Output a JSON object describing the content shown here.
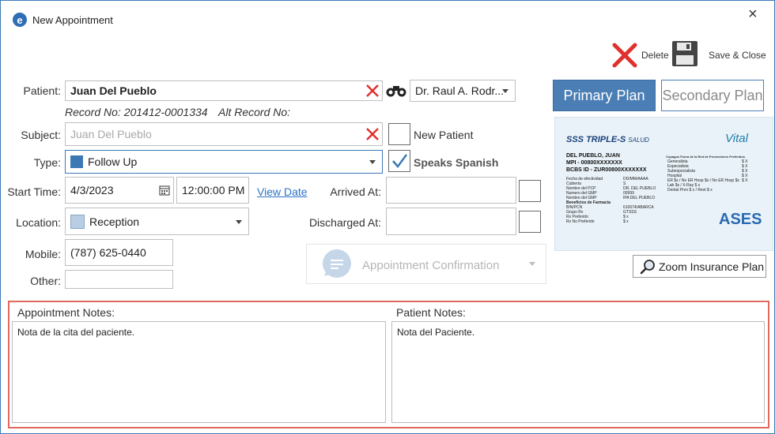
{
  "window": {
    "title": "New Appointment",
    "close_glyph": "×"
  },
  "toolbar": {
    "delete_label": "Delete",
    "save_close_label": "Save & Close"
  },
  "patient": {
    "label": "Patient:",
    "value": "Juan Del Pueblo",
    "record_no": "Record No: 201412-0001334",
    "alt_record_no": "Alt Record No:",
    "doctor": "Dr. Raul A. Rodr..."
  },
  "subject": {
    "label": "Subject:",
    "placeholder": "Juan Del Pueblo"
  },
  "new_patient_label": "New Patient",
  "speaks_spanish_label": "Speaks Spanish",
  "type": {
    "label": "Type:",
    "value": "Follow Up",
    "color": "#3c78b4"
  },
  "start_time": {
    "label": "Start Time:",
    "date": "4/3/2023",
    "time": "12:00:00 PM",
    "view_date_link": "View Date"
  },
  "arrived_at_label": "Arrived At:",
  "discharged_at_label": "Discharged At:",
  "location": {
    "label": "Location:",
    "value": "Reception",
    "color": "#b9cde4"
  },
  "mobile": {
    "label": "Mobile:",
    "value": "(787) 625-0440"
  },
  "other": {
    "label": "Other:",
    "value": ""
  },
  "appointment_confirmation_label": "Appointment Confirmation",
  "plans": {
    "primary": "Primary Plan",
    "secondary": "Secondary Plan",
    "zoom": "Zoom Insurance Plan"
  },
  "insurance_card": {
    "brand": "TRIPLE-S",
    "brand_suffix": "SALUD",
    "partner": "Vital",
    "name": "DEL PUEBLO, JUAN",
    "mpi": "MPI - 00800XXXXXXX",
    "bcbs": "BCBS ID - ZUR00800XXXXXXX",
    "fields": [
      {
        "k": "Fecha de efectividad",
        "v": "DD/MM/AAAA"
      },
      {
        "k": "Cubierta",
        "v": "S"
      },
      {
        "k": "Nombre del PCP",
        "v": "DR. DEL PUEBLO"
      },
      {
        "k": "Numero del GMP",
        "v": "00999"
      },
      {
        "k": "Nombre del GMP",
        "v": "IPA DEL PUEBLO"
      },
      {
        "k": "Beneficios de Farmacia",
        "v": ""
      },
      {
        "k": "BIN/PCN",
        "v": "610674/ABARCA"
      },
      {
        "k": "Grupo Rx",
        "v": "GTSSS"
      },
      {
        "k": "Rx Preferido",
        "v": "$ x"
      },
      {
        "k": "Rx No Preferido",
        "v": "$ x"
      }
    ],
    "copay_title": "Copagos Fuera de la Red de Proveedores Preferidos",
    "copays": [
      {
        "k": "Generalista",
        "v": "$ X"
      },
      {
        "k": "Especialista",
        "v": "$ X"
      },
      {
        "k": "Subespecialista",
        "v": "$ X"
      },
      {
        "k": "Hospital",
        "v": "$ X"
      },
      {
        "k": "ER $x / No ER Hosp $x / No ER Hosp $x",
        "v": "$ X"
      },
      {
        "k": "Lab $x / X-Ray $ x",
        "v": ""
      },
      {
        "k": "Dental Prev $ x / Rest $ x",
        "v": ""
      }
    ],
    "ases": "ASES"
  },
  "notes": {
    "appointment_label": "Appointment Notes:",
    "appointment_value": "Nota de la cita del paciente.",
    "patient_label": "Patient Notes:",
    "patient_value": "Nota del Paciente."
  },
  "colors": {
    "primary_plan_bg": "#4a7eb5",
    "highlight_border": "#e06a5e",
    "delete_red": "#e0312d"
  }
}
